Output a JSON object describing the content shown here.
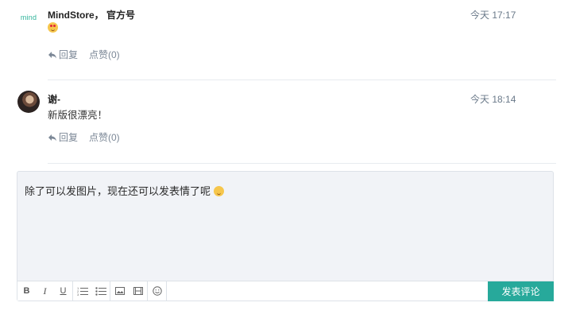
{
  "comments": [
    {
      "author": "MindStore， 官方号",
      "time": "今天 17:17",
      "avatar_text": "mind",
      "emoji": "heart-eyes",
      "reply_label": "回复",
      "like_label": "点赞(0)"
    },
    {
      "author": "谢-",
      "time": "今天 18:14",
      "text": "新版很漂亮！",
      "reply_label": "回复",
      "like_label": "点赞(0)"
    }
  ],
  "composer": {
    "text": "除了可以发图片，现在还可以发表情了呢",
    "emoji": "smile",
    "submit_label": "发表评论",
    "toolbar": [
      "bold",
      "italic",
      "underline",
      "ordered-list",
      "bullet-list",
      "image",
      "video",
      "emoji"
    ]
  },
  "colors": {
    "accent": "#27a99b",
    "muted": "#7b8796"
  }
}
